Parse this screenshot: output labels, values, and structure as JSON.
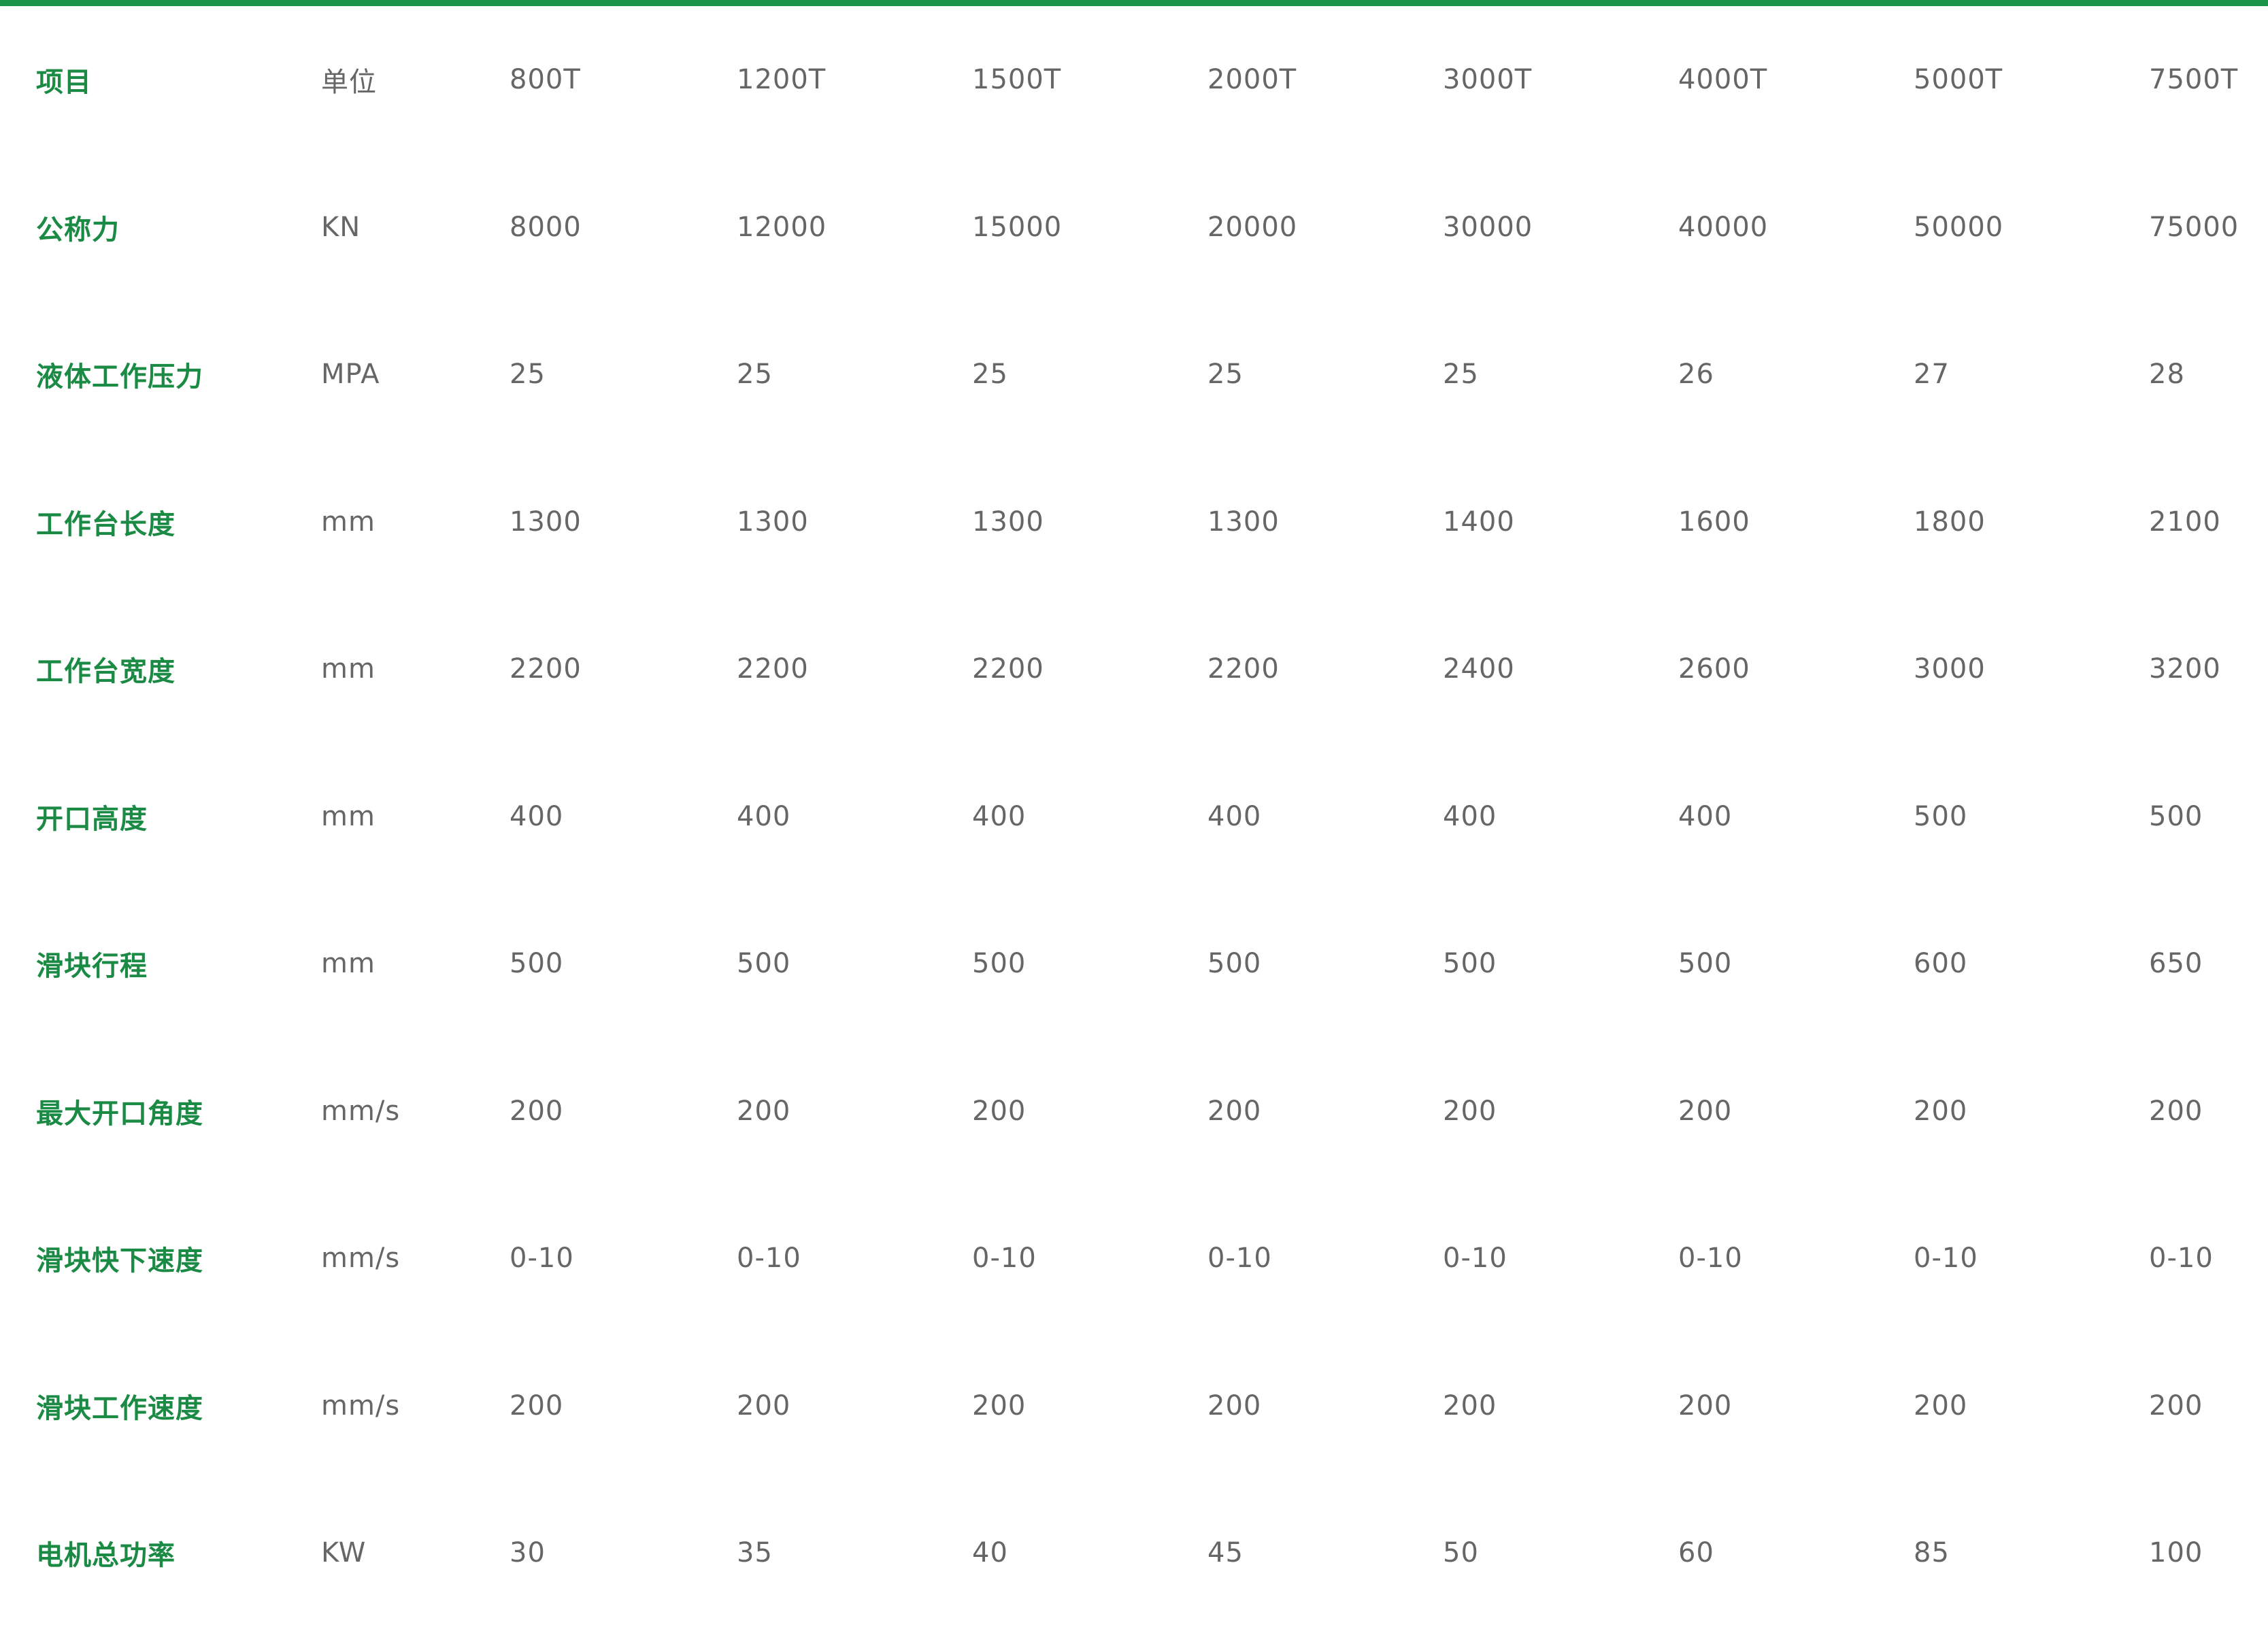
{
  "accent_color": "#1b9448",
  "header": {
    "item": "项目",
    "unit": "单位",
    "models": [
      "800T",
      "1200T",
      "1500T",
      "2000T",
      "3000T",
      "4000T",
      "5000T",
      "7500T"
    ]
  },
  "rows": [
    {
      "item": "公称力",
      "unit": "KN",
      "values": [
        "8000",
        "12000",
        "15000",
        "20000",
        "30000",
        "40000",
        "50000",
        "75000"
      ]
    },
    {
      "item": "液体工作压力",
      "unit": "MPA",
      "values": [
        "25",
        "25",
        "25",
        "25",
        "25",
        "26",
        "27",
        "28"
      ]
    },
    {
      "item": "工作台长度",
      "unit": "mm",
      "values": [
        "1300",
        "1300",
        "1300",
        "1300",
        "1400",
        "1600",
        "1800",
        "2100"
      ]
    },
    {
      "item": "工作台宽度",
      "unit": "mm",
      "values": [
        "2200",
        "2200",
        "2200",
        "2200",
        "2400",
        "2600",
        "3000",
        "3200"
      ]
    },
    {
      "item": "开口高度",
      "unit": "mm",
      "values": [
        "400",
        "400",
        "400",
        "400",
        "400",
        "400",
        "500",
        "500"
      ]
    },
    {
      "item": "滑块行程",
      "unit": "mm",
      "values": [
        "500",
        "500",
        "500",
        "500",
        "500",
        "500",
        "600",
        "650"
      ]
    },
    {
      "item": "最大开口角度",
      "unit": "mm/s",
      "values": [
        "200",
        "200",
        "200",
        "200",
        "200",
        "200",
        "200",
        "200"
      ]
    },
    {
      "item": "滑块快下速度",
      "unit": "mm/s",
      "values": [
        "0-10",
        "0-10",
        "0-10",
        "0-10",
        "0-10",
        "0-10",
        "0-10",
        "0-10"
      ]
    },
    {
      "item": "滑块工作速度",
      "unit": "mm/s",
      "values": [
        "200",
        "200",
        "200",
        "200",
        "200",
        "200",
        "200",
        "200"
      ]
    },
    {
      "item": "电机总功率",
      "unit": "KW",
      "values": [
        "30",
        "35",
        "40",
        "45",
        "50",
        "60",
        "85",
        "100"
      ]
    }
  ]
}
